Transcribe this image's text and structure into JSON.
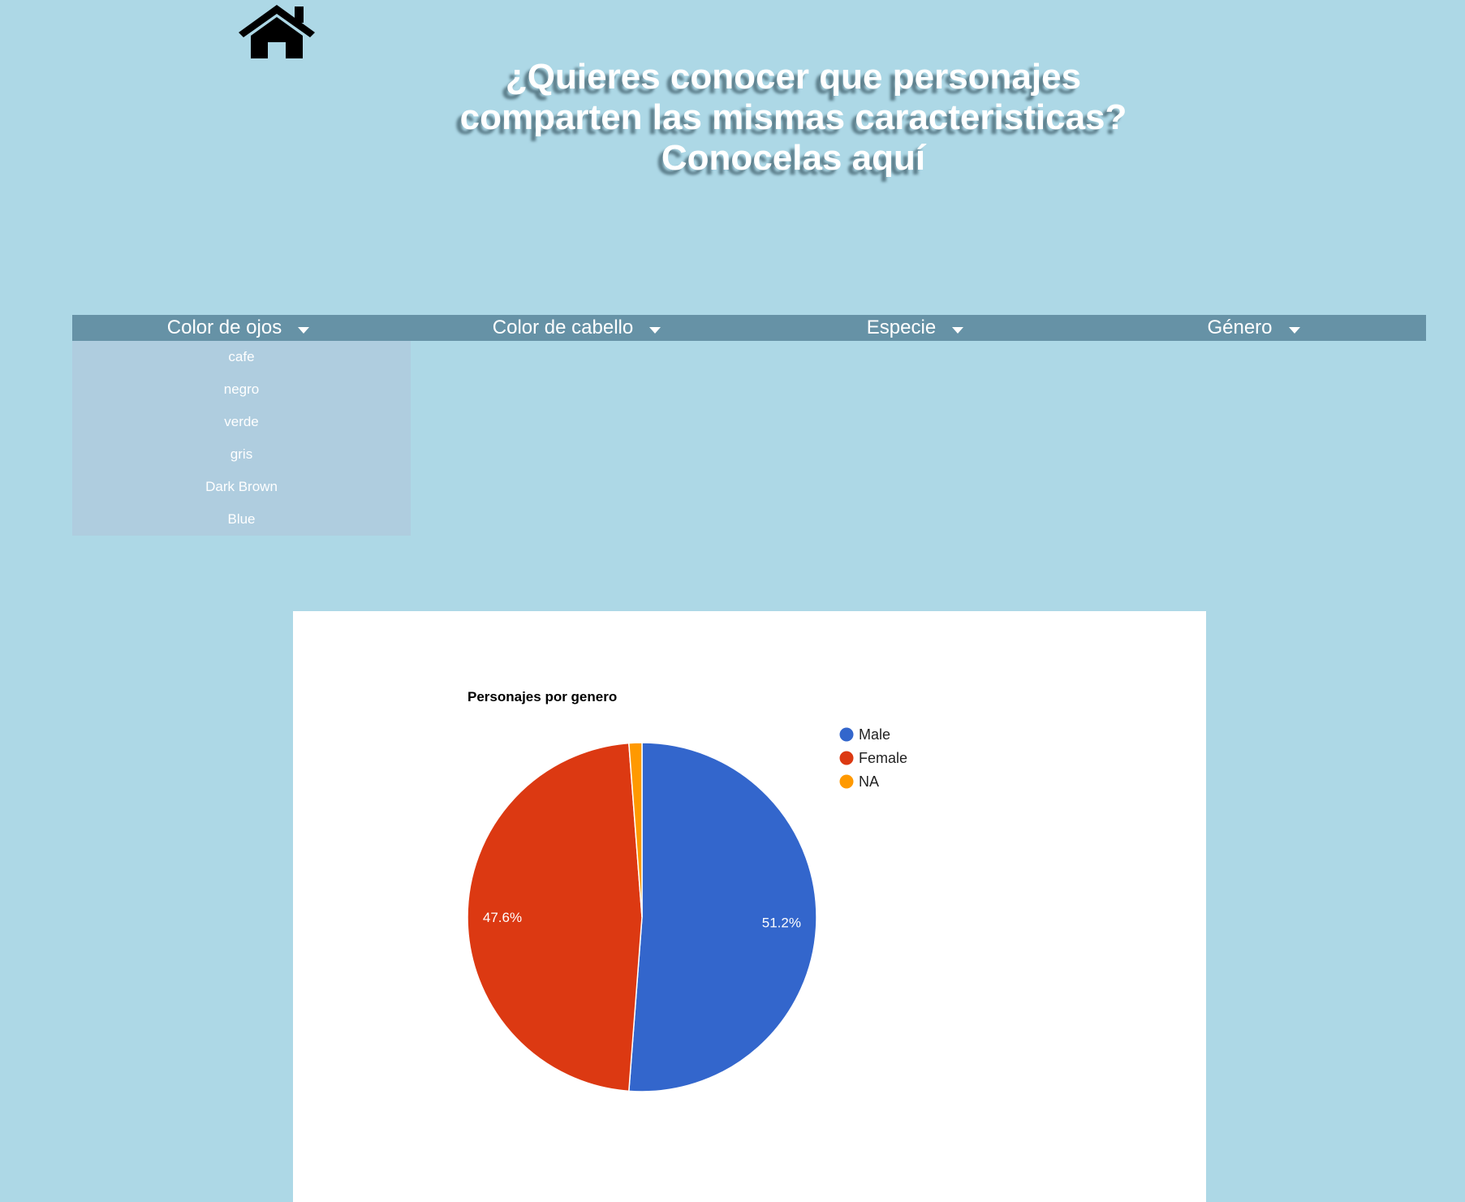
{
  "header": {
    "home_icon": "house-icon",
    "title_lines": [
      "¿Quieres conocer que personajes",
      "comparten las mismas caracteristicas?",
      "Conocelas aquí"
    ]
  },
  "filters": {
    "tabs": [
      {
        "label": "Color de ojos",
        "icon": "caret-down-icon"
      },
      {
        "label": "Color de cabello",
        "icon": "caret-down-icon"
      },
      {
        "label": "Especie",
        "icon": "caret-down-icon"
      },
      {
        "label": "Género",
        "icon": "caret-down-icon"
      }
    ],
    "open_dropdown": {
      "tab": "Color de ojos",
      "options": [
        "cafe",
        "negro",
        "verde",
        "gris",
        "Dark Brown",
        "Blue"
      ]
    }
  },
  "colors": {
    "page_background": "#add8e6",
    "filter_bar": "#6692a6",
    "dropdown_background": "#afcddf",
    "title_shadow": "#5d7f8c"
  },
  "chart_data": {
    "type": "pie",
    "title": "Personajes por genero",
    "slices": [
      {
        "label": "Male",
        "value": 51.2,
        "display": "51.2%",
        "color": "#3366cc"
      },
      {
        "label": "Female",
        "value": 47.6,
        "display": "47.6%",
        "color": "#dc3912"
      },
      {
        "label": "NA",
        "value": 1.2,
        "display": "",
        "color": "#ff9900"
      }
    ],
    "legend": {
      "position": "right",
      "entries": [
        "Male",
        "Female",
        "NA"
      ]
    }
  }
}
